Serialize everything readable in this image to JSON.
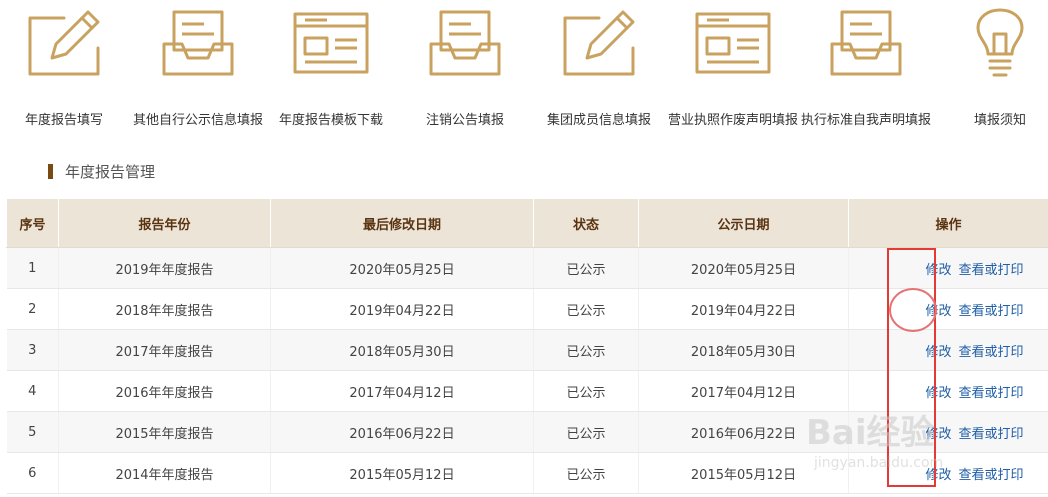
{
  "toolbar": {
    "items": [
      {
        "label": "年度报告填写",
        "icon": "pencil-edit-icon"
      },
      {
        "label": "其他自行公示信息填报",
        "icon": "inbox-tray-icon"
      },
      {
        "label": "年度报告模板下载",
        "icon": "browser-window-icon"
      },
      {
        "label": "注销公告填报",
        "icon": "inbox-tray-icon"
      },
      {
        "label": "集团成员信息填报",
        "icon": "pencil-edit-icon"
      },
      {
        "label": "营业执照作废声明填报",
        "icon": "browser-window-icon"
      },
      {
        "label": "执行标准自我声明填报",
        "icon": "inbox-tray-icon"
      },
      {
        "label": "填报须知",
        "icon": "lightbulb-icon"
      }
    ]
  },
  "section": {
    "title": "年度报告管理"
  },
  "table": {
    "headers": [
      "序号",
      "报告年份",
      "最后修改日期",
      "状态",
      "公示日期",
      "操作"
    ],
    "rows": [
      {
        "no": "1",
        "year": "2019年年度报告",
        "modified": "2020年05月25日",
        "status": "已公示",
        "published": "2020年05月25日",
        "edit": "修改",
        "view": "查看或打印"
      },
      {
        "no": "2",
        "year": "2018年年度报告",
        "modified": "2019年04月22日",
        "status": "已公示",
        "published": "2019年04月22日",
        "edit": "修改",
        "view": "查看或打印"
      },
      {
        "no": "3",
        "year": "2017年年度报告",
        "modified": "2018年05月30日",
        "status": "已公示",
        "published": "2018年05月30日",
        "edit": "修改",
        "view": "查看或打印"
      },
      {
        "no": "4",
        "year": "2016年年度报告",
        "modified": "2017年04月12日",
        "status": "已公示",
        "published": "2017年04月12日",
        "edit": "修改",
        "view": "查看或打印"
      },
      {
        "no": "5",
        "year": "2015年年度报告",
        "modified": "2016年06月22日",
        "status": "已公示",
        "published": "2016年06月22日",
        "edit": "修改",
        "view": "查看或打印"
      },
      {
        "no": "6",
        "year": "2014年年度报告",
        "modified": "2015年05月12日",
        "status": "已公示",
        "published": "2015年05月12日",
        "edit": "修改",
        "view": "查看或打印"
      }
    ]
  },
  "watermark": {
    "main": "Bai经验",
    "sub": "jingyan.baidu.com"
  },
  "colors": {
    "icon_gold": "#c9a25f",
    "header_bg": "#ede4d8",
    "header_text": "#5a3410",
    "link": "#1f5ea8",
    "highlight": "#e53935"
  }
}
